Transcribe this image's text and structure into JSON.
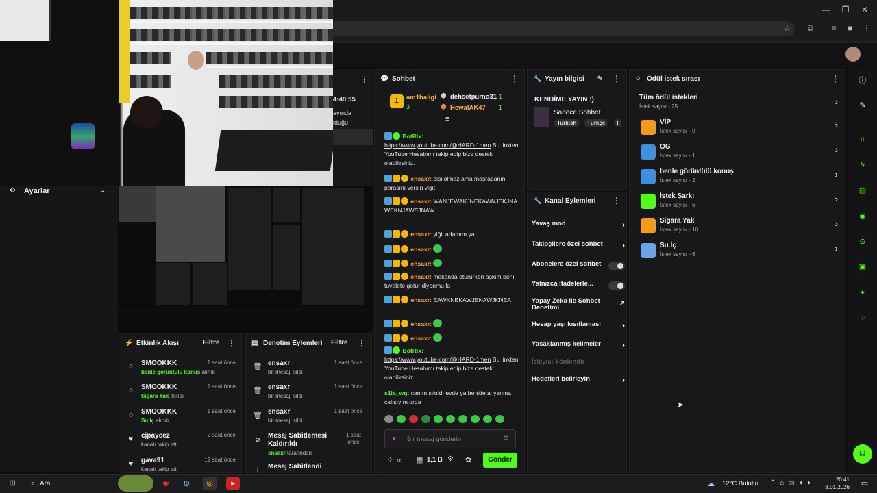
{
  "browser": {
    "window_controls": [
      "—",
      "❐",
      "✕"
    ]
  },
  "camera_overlay": {
    "settings_label": "Ayarlar",
    "partial_time": "4:48:55",
    "partial_text_1": "ayında",
    "partial_text_2": "lduğu"
  },
  "activity_feed": {
    "title": "Etkinlik Akışı",
    "filter": "Filtre",
    "items": [
      {
        "user": "SMOOKKK",
        "reward": "benle görüntülü konuş",
        "suffix": " alındı",
        "time": "1 saat önce"
      },
      {
        "user": "SMOOKKK",
        "reward": "Sigara Yak",
        "suffix": " alındı",
        "time": "1 saat önce"
      },
      {
        "user": "SMOOKKK",
        "reward": "Su İç",
        "suffix": " alındı",
        "time": "1 saat önce"
      },
      {
        "user": "cjpaycez",
        "reward": "",
        "suffix": "kanalı takip etti",
        "time": "2 saat önce"
      },
      {
        "user": "gava91",
        "reward": "",
        "suffix": "kanalı takip etti",
        "time": "19 saat önce"
      }
    ]
  },
  "moderation": {
    "title": "Denetim Eylemleri",
    "filter": "Filtre",
    "items": [
      {
        "user": "ensaxr",
        "action": "bir mesajı sildi",
        "time": "1 saat önce"
      },
      {
        "user": "ensaxr",
        "action": "bir mesajı sildi",
        "time": "1 saat önce"
      },
      {
        "user": "ensaxr",
        "action": "bir mesajı sildi",
        "time": "1 saat önce"
      },
      {
        "user": "Mesaj Sabitlemesi Kaldırıldı",
        "by": "ensaxr",
        "action_suffix": " tarafından",
        "time": "1 saat önce"
      },
      {
        "user": "Mesaj Sabitlendi",
        "action": "",
        "time": ""
      }
    ]
  },
  "chat": {
    "title": "Sohbet",
    "leaders": [
      {
        "name": "am1baligi",
        "count": "3"
      },
      {
        "name": "dehsetpurno31",
        "count": "1"
      },
      {
        "name": "HewalAK47",
        "count": "1"
      }
    ],
    "messages": [
      {
        "user": "BotRix:",
        "text": "https://www.youtube.com/@HARD-1men",
        "rest": " Bu linkten YouTube Hesabımı takip edip bize destek olabilirsiniz."
      },
      {
        "user": "ensaxr:",
        "text": "bisi olmaz ama maşrapanın parasını versin yigit"
      },
      {
        "user": "ensaxr:",
        "text": "WANJEWAKJNEKAWNJEKJNAWEKNJAWEJNAW"
      },
      {
        "user": "ensaxr:",
        "text": "yiğit adamım ya"
      },
      {
        "user": "ensaxr:",
        "text": ""
      },
      {
        "user": "ensaxr:",
        "text": ""
      },
      {
        "user": "ensaxr:",
        "text": "mekanda otururken aşkım beni tuvalete gotur diyonmu la"
      },
      {
        "user": "ensaxr:",
        "text": "EAWKNEKAWJENAWJKNEA"
      },
      {
        "user": "ensaxr:",
        "text": ""
      },
      {
        "user": "ensaxr:",
        "text": ""
      },
      {
        "user": "BotRix:",
        "text": "https://www.youtube.com/@HARD-1men",
        "rest": " Bu linkten YouTube Hesabımı takip edip bize destek olabilirsiniz."
      },
      {
        "user": "s1la_wq:",
        "text": "canım sıkıldı evde ya benide al yanına çalışıyım orda"
      }
    ],
    "input_placeholder": "Bir mesaj gönderin",
    "points": "1,1 B",
    "send": "Gönder",
    "infinity": "∞"
  },
  "stream_info": {
    "title": "Yayın bilgisi",
    "stream_title": "KENDİME YAYIN :)",
    "category": "Sadece Sohbet",
    "tags": [
      "Turkish",
      "Türkçe",
      "T"
    ]
  },
  "channel_actions": {
    "title": "Kanal Eylemleri",
    "items": [
      {
        "label": "Yavaş mod",
        "kind": "chevron"
      },
      {
        "label": "Takipçilere özel sohbet",
        "kind": "chevron"
      },
      {
        "label": "Abonelere özel sohbet",
        "kind": "toggle"
      },
      {
        "label": "Yalnızca ifadelerle...",
        "kind": "toggle"
      },
      {
        "label": "Yapay Zeka ile Sohbet Denetimi",
        "kind": "external"
      },
      {
        "label": "Hesap yaşı kısıtlaması",
        "kind": "chevron"
      },
      {
        "label": "Yasaklanmış kelimeler",
        "kind": "chevron"
      },
      {
        "label": "İzleyici Yönlendir",
        "kind": "disabled"
      },
      {
        "label": "Hedefleri belirleyin",
        "kind": "chevron"
      }
    ]
  },
  "reward_queue": {
    "title": "Ödül istek sırası",
    "all": {
      "title": "Tüm ödül istekleri",
      "sub": "İstek sayısı - 25"
    },
    "items": [
      {
        "title": "VİP",
        "sub": "İstek sayısı - 0",
        "color": "#f29b1a"
      },
      {
        "title": "OG",
        "sub": "İstek sayısı - 1",
        "color": "#3f8fe0"
      },
      {
        "title": "benle görüntülü konuş",
        "sub": "İstek sayısı - 2",
        "color": "#3f8fe0"
      },
      {
        "title": "İstek Şarkı",
        "sub": "İstek sayısı - 6",
        "color": "#53fc18"
      },
      {
        "title": "Sigara Yak",
        "sub": "İstek sayısı - 10",
        "color": "#f29b1a"
      },
      {
        "title": "Su İç",
        "sub": "İstek sayısı - 6",
        "color": "#6aa5e8"
      }
    ]
  },
  "taskbar": {
    "search": "Ara",
    "weather": "12°C Bulutlu",
    "time": "20:41",
    "date": "8.01.2026"
  },
  "colors": {
    "accent": "#53fc18",
    "panel": "#18181b",
    "background": "#0f0f10"
  }
}
